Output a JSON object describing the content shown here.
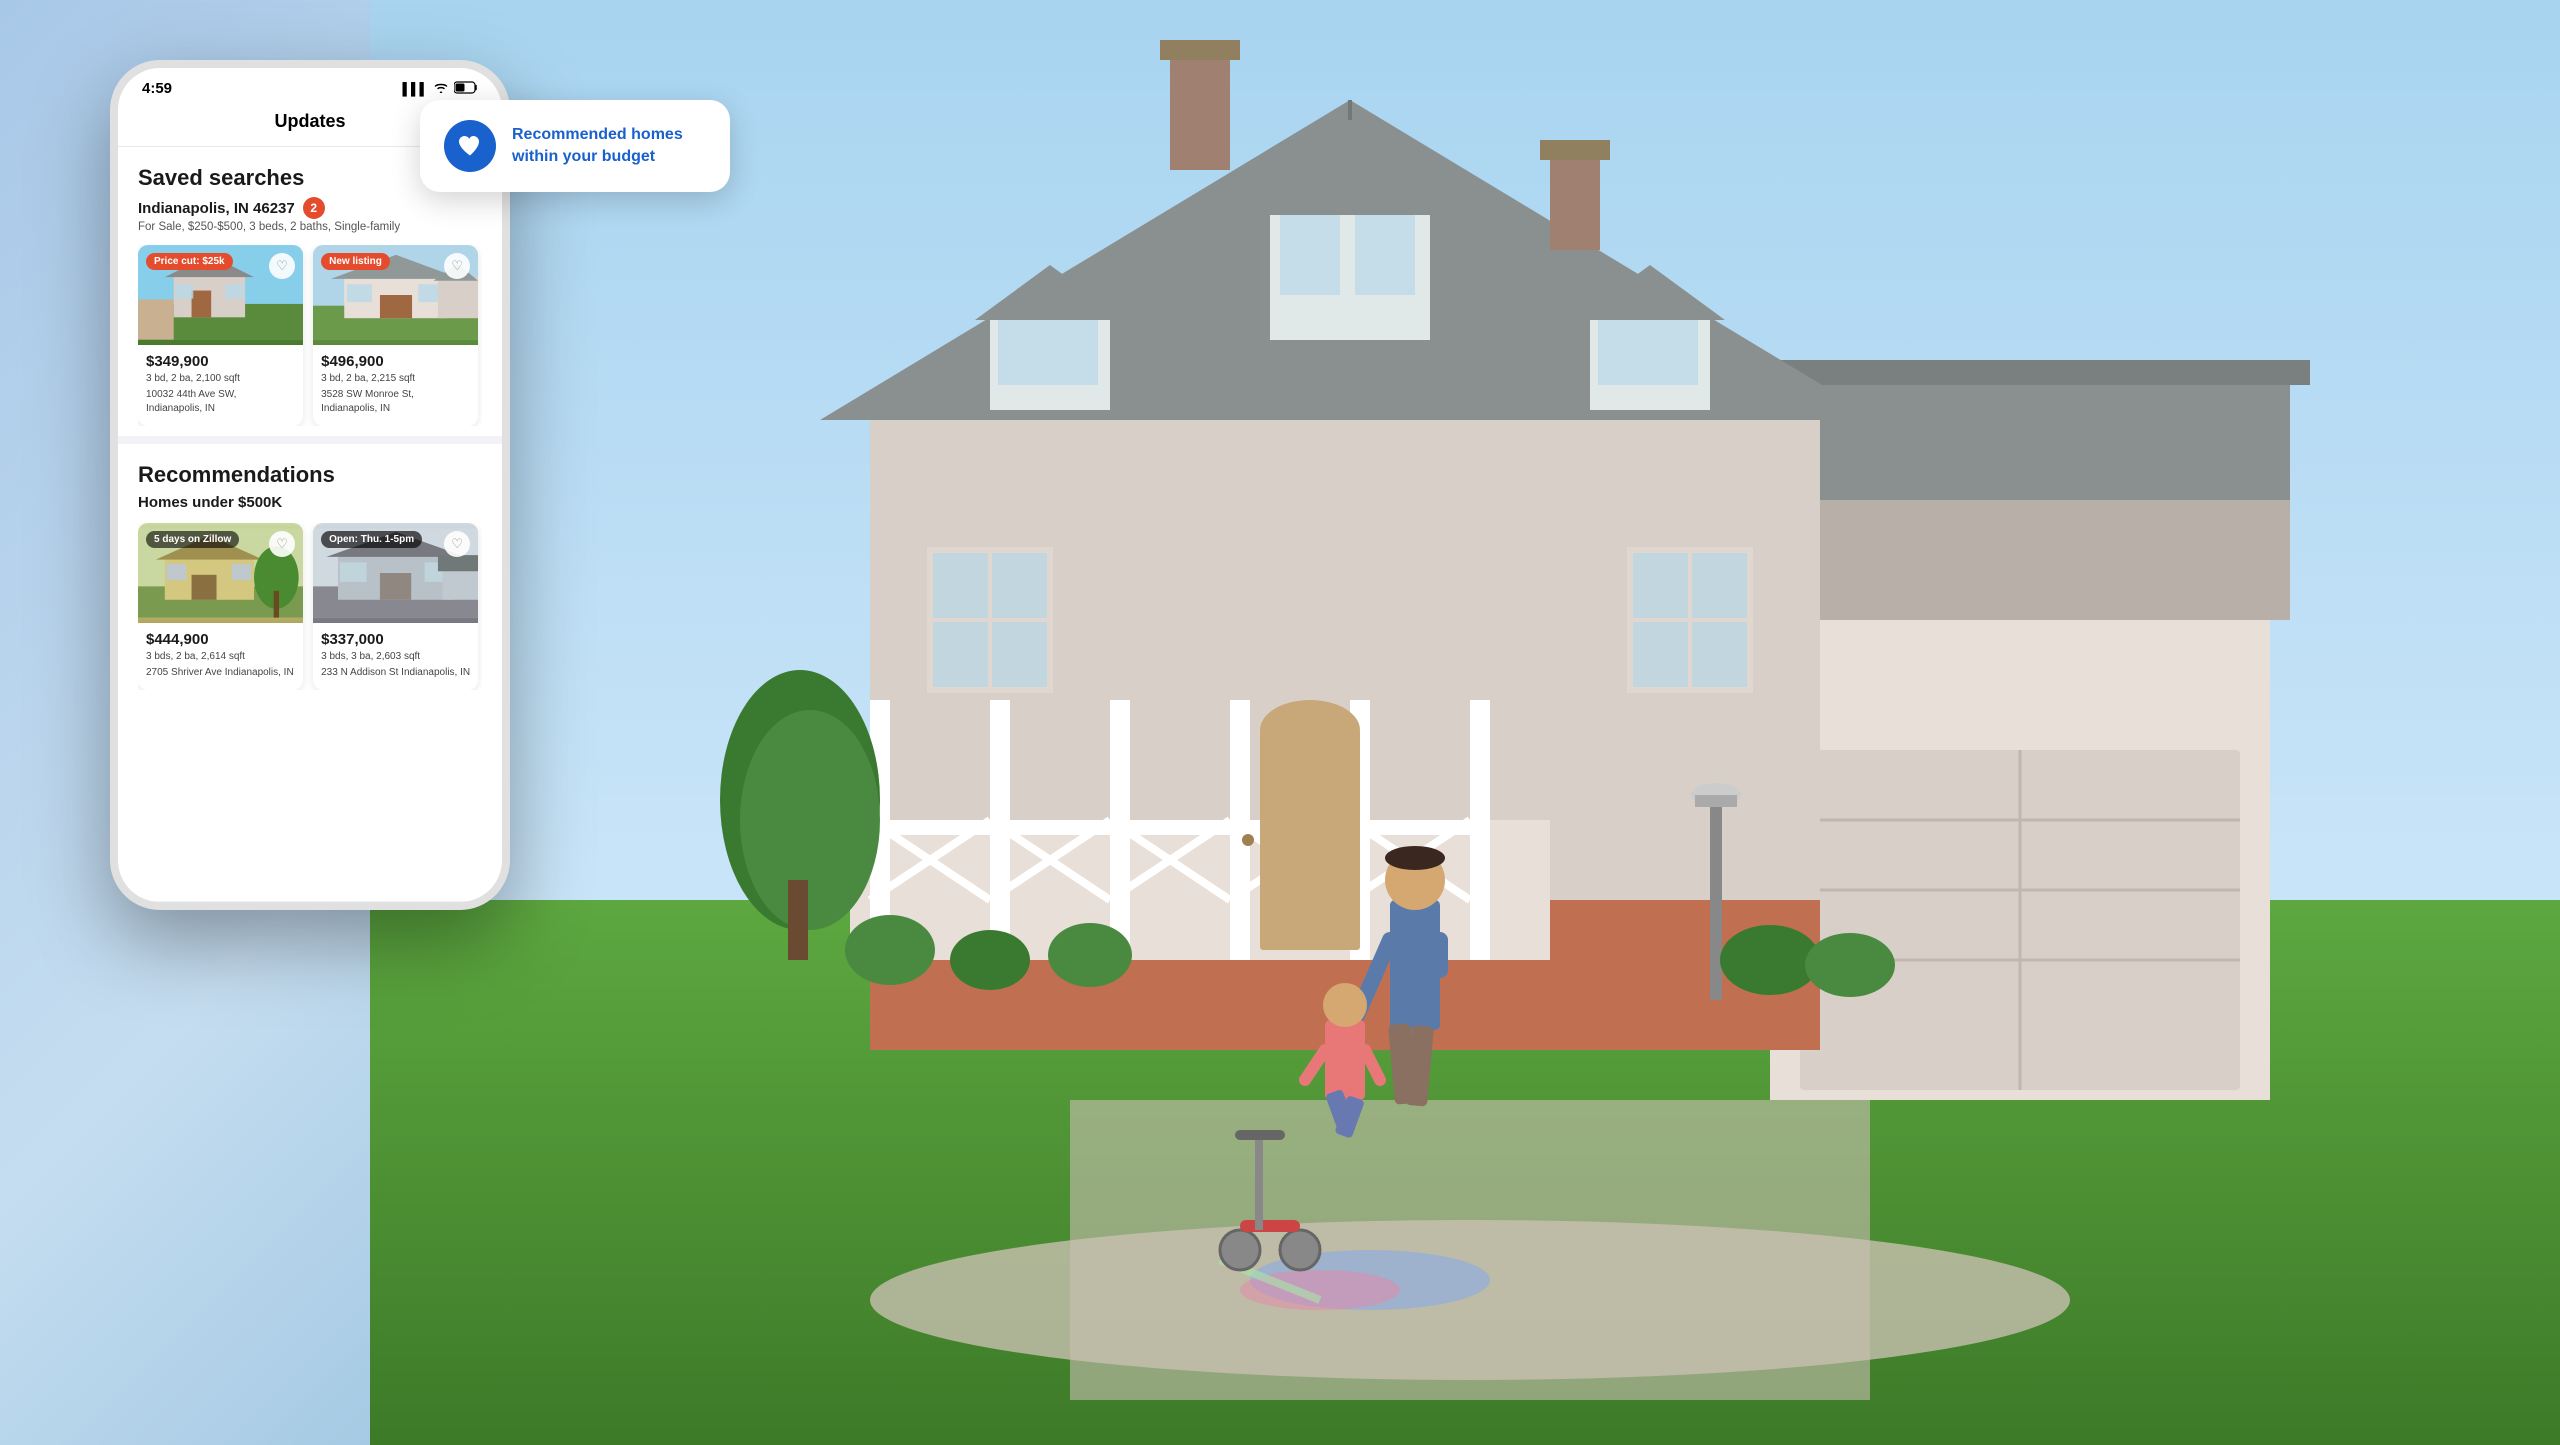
{
  "background": {
    "dark_blue": "#003087",
    "sky": "#87CEEB"
  },
  "notification": {
    "icon": "♥",
    "icon_bg": "#1961cc",
    "text": "Recommended homes within your budget"
  },
  "phone": {
    "status_bar": {
      "time": "4:59",
      "signal": "▌▌▌",
      "wifi": "WiFi",
      "battery": "🔋"
    },
    "header": {
      "title": "Updates"
    },
    "saved_searches": {
      "section_title": "Saved searches",
      "location": "Indianapolis, IN 46237",
      "badge": "2",
      "subtitle": "For Sale, $250-$500, 3 beds, 2 baths, Single-family",
      "listings": [
        {
          "tag": "Price cut: $25k",
          "tag_type": "price-cut",
          "price": "$349,900",
          "details": "3 bd, 2 ba, 2,100 sqft",
          "address": "10032 44th Ave SW, Indianapolis, IN"
        },
        {
          "tag": "New listing",
          "tag_type": "new-listing",
          "price": "$496,900",
          "details": "3 bd, 2 ba, 2,215 sqft",
          "address": "3528 SW Monroe St, Indianapolis, IN"
        }
      ]
    },
    "recommendations": {
      "section_title": "Recommendations",
      "subsection": "Homes under $500K",
      "listings": [
        {
          "tag": "5 days on Zillow",
          "tag_type": "days",
          "price": "$444,900",
          "details": "3 bds, 2 ba, 2,614 sqft",
          "address": "2705 Shriver Ave Indianapolis, IN"
        },
        {
          "tag": "Open: Thu. 1-5pm",
          "tag_type": "open",
          "price": "$337,000",
          "details": "3 bds, 3 ba, 2,603 sqft",
          "address": "233 N Addison St Indianapolis, IN"
        }
      ]
    }
  }
}
